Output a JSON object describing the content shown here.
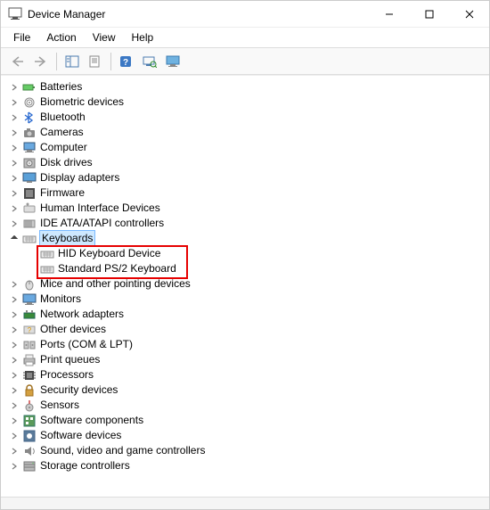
{
  "window": {
    "title": "Device Manager"
  },
  "menu": {
    "file": "File",
    "action": "Action",
    "view": "View",
    "help": "Help"
  },
  "toolbar_icons": {
    "back": "back-arrow",
    "forward": "forward-arrow",
    "show_hide": "panel-toggle",
    "properties": "properties",
    "help": "help",
    "scan": "scan-hardware",
    "monitor": "monitor"
  },
  "tree": [
    {
      "label": "Batteries",
      "icon": "battery",
      "expandable": true
    },
    {
      "label": "Biometric devices",
      "icon": "fingerprint",
      "expandable": true
    },
    {
      "label": "Bluetooth",
      "icon": "bluetooth",
      "expandable": true
    },
    {
      "label": "Cameras",
      "icon": "camera",
      "expandable": true
    },
    {
      "label": "Computer",
      "icon": "computer",
      "expandable": true
    },
    {
      "label": "Disk drives",
      "icon": "disk",
      "expandable": true
    },
    {
      "label": "Display adapters",
      "icon": "display",
      "expandable": true
    },
    {
      "label": "Firmware",
      "icon": "firmware",
      "expandable": true
    },
    {
      "label": "Human Interface Devices",
      "icon": "hid",
      "expandable": true
    },
    {
      "label": "IDE ATA/ATAPI controllers",
      "icon": "ide",
      "expandable": true
    },
    {
      "label": "Keyboards",
      "icon": "keyboard",
      "expandable": true,
      "expanded": true,
      "selected": true,
      "children": [
        {
          "label": "HID Keyboard Device",
          "icon": "keyboard"
        },
        {
          "label": "Standard PS/2 Keyboard",
          "icon": "keyboard"
        }
      ]
    },
    {
      "label": "Mice and other pointing devices",
      "icon": "mouse",
      "expandable": true
    },
    {
      "label": "Monitors",
      "icon": "monitor",
      "expandable": true
    },
    {
      "label": "Network adapters",
      "icon": "network",
      "expandable": true
    },
    {
      "label": "Other devices",
      "icon": "other",
      "expandable": true
    },
    {
      "label": "Ports (COM & LPT)",
      "icon": "ports",
      "expandable": true
    },
    {
      "label": "Print queues",
      "icon": "printer",
      "expandable": true
    },
    {
      "label": "Processors",
      "icon": "processor",
      "expandable": true
    },
    {
      "label": "Security devices",
      "icon": "security",
      "expandable": true
    },
    {
      "label": "Sensors",
      "icon": "sensor",
      "expandable": true
    },
    {
      "label": "Software components",
      "icon": "software",
      "expandable": true
    },
    {
      "label": "Software devices",
      "icon": "software-dev",
      "expandable": true
    },
    {
      "label": "Sound, video and game controllers",
      "icon": "sound",
      "expandable": true
    },
    {
      "label": "Storage controllers",
      "icon": "storage",
      "expandable": true
    }
  ],
  "highlight_color": "#e60000"
}
